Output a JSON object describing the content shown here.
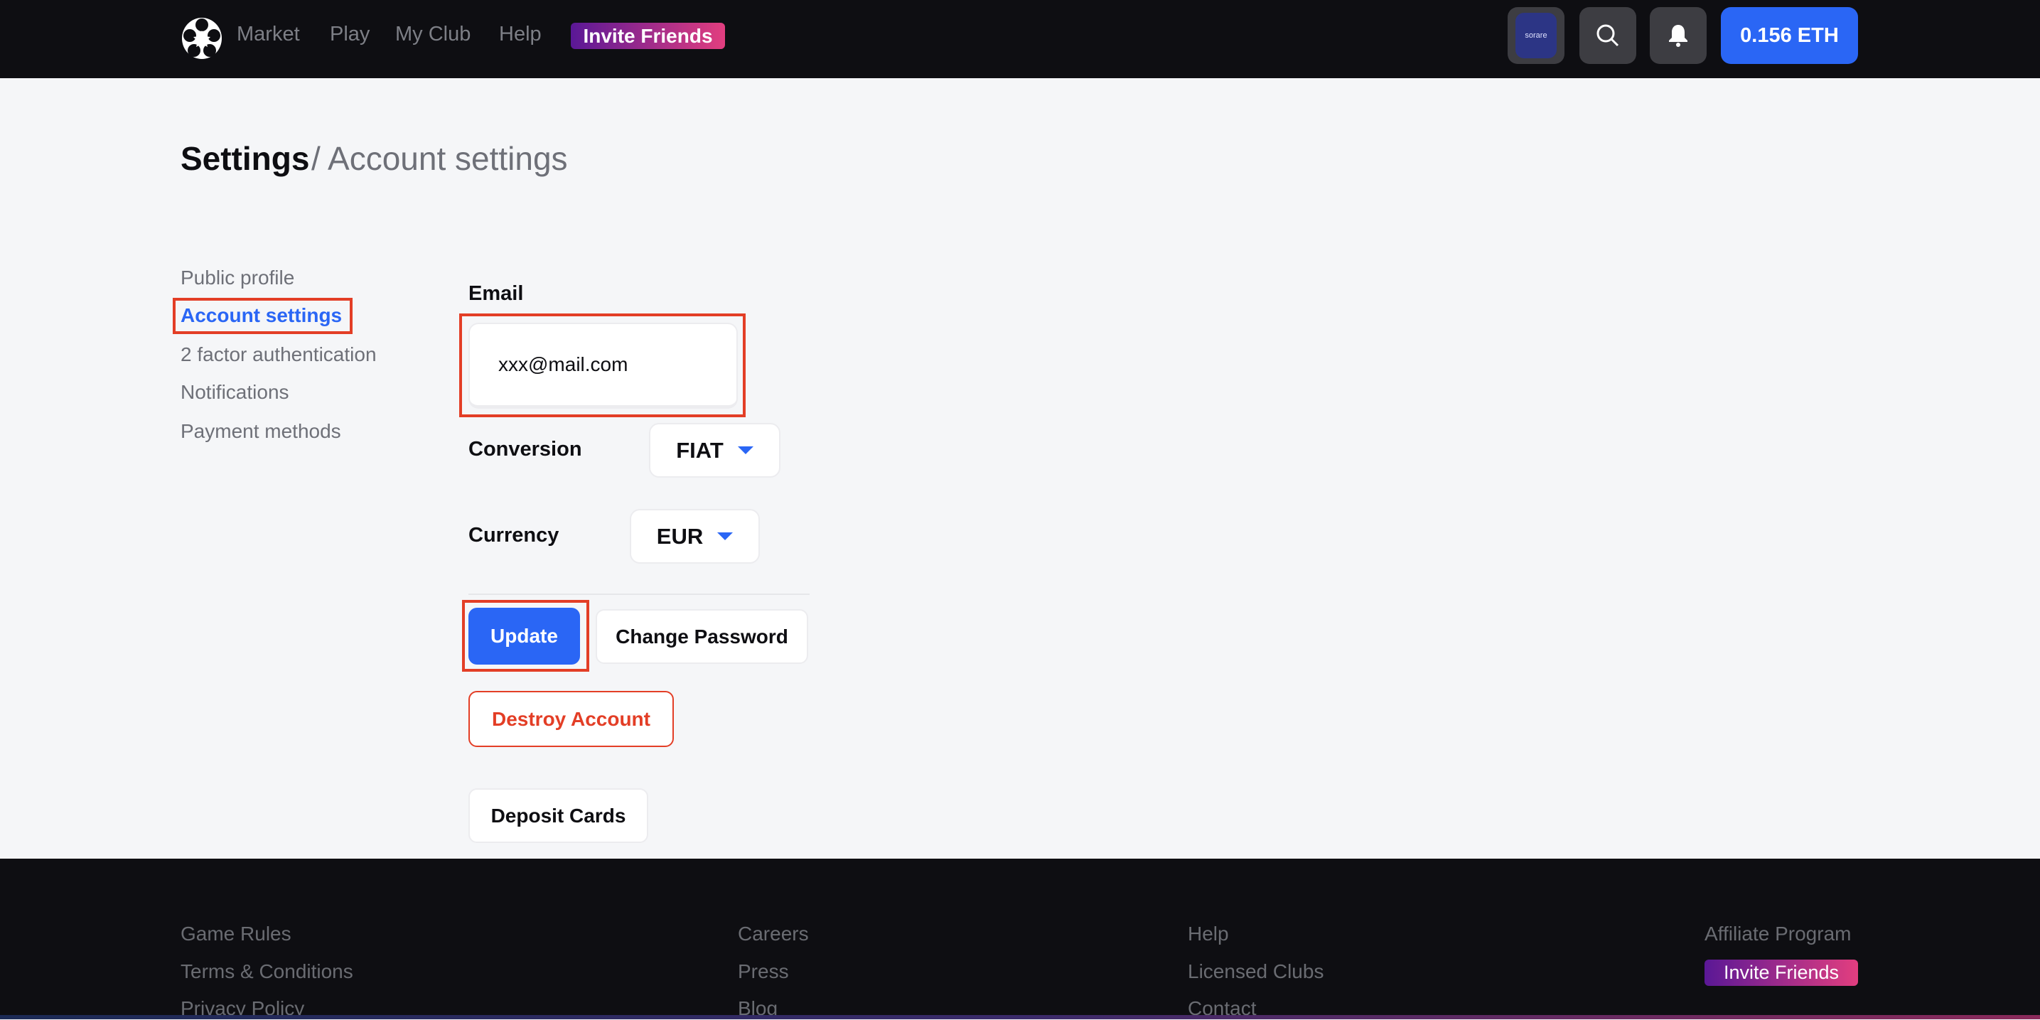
{
  "header": {
    "nav": [
      "Market",
      "Play",
      "My Club",
      "Help"
    ],
    "invite_label": "Invite Friends",
    "avatar_text": "sorare",
    "balance": "0.156 ETH"
  },
  "page": {
    "title": "Settings",
    "breadcrumb": "/ Account settings"
  },
  "sidebar": {
    "items": [
      {
        "label": "Public profile"
      },
      {
        "label": "Account settings",
        "active": true
      },
      {
        "label": "2 factor authentication"
      },
      {
        "label": "Notifications"
      },
      {
        "label": "Payment methods"
      }
    ]
  },
  "form": {
    "email_label": "Email",
    "email_value": "xxx@mail.com",
    "conversion_label": "Conversion",
    "conversion_value": "FIAT",
    "currency_label": "Currency",
    "currency_value": "EUR",
    "update_label": "Update",
    "change_password_label": "Change Password",
    "destroy_label": "Destroy Account",
    "deposit_cards_label": "Deposit Cards"
  },
  "footer": {
    "col1": [
      "Game Rules",
      "Terms & Conditions",
      "Privacy Policy"
    ],
    "col2": [
      "Careers",
      "Press",
      "Blog"
    ],
    "col3": [
      "Help",
      "Licensed Clubs",
      "Contact"
    ],
    "col4": [
      "Affiliate Program"
    ],
    "invite_label": "Invite Friends"
  },
  "colors": {
    "accent": "#2a66f5",
    "danger": "#e33e26",
    "header_bg": "#0e0e12",
    "annotation": "#e33e26"
  }
}
